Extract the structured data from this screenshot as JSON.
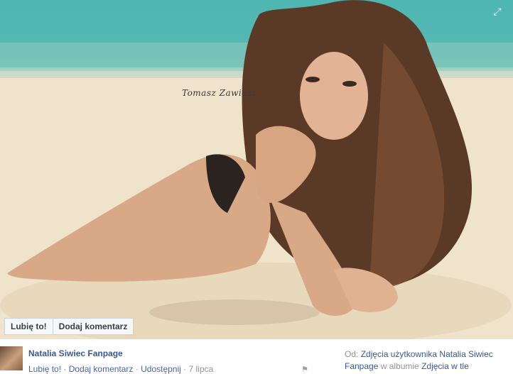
{
  "photo": {
    "signature_text": "Tomasz Zawiasz",
    "expand_icon": "expand-icon"
  },
  "actions": {
    "like_label": "Lubię to!",
    "comment_label": "Dodaj komentarz"
  },
  "footer": {
    "page_name": "Natalia Siwiec Fanpage",
    "meta": {
      "like": "Lubię to!",
      "sep1": " · ",
      "comment": "Dodaj komentarz",
      "sep2": " · ",
      "share": "Udostępnij",
      "sep3": " · ",
      "date": "7 lipca"
    },
    "source": {
      "from_label": "Od: ",
      "album_owner": "Zdjęcia użytkownika Natalia Siwiec Fanpage",
      "in_album": " w albumie ",
      "album_name": "Zdjęcia w tle"
    }
  }
}
